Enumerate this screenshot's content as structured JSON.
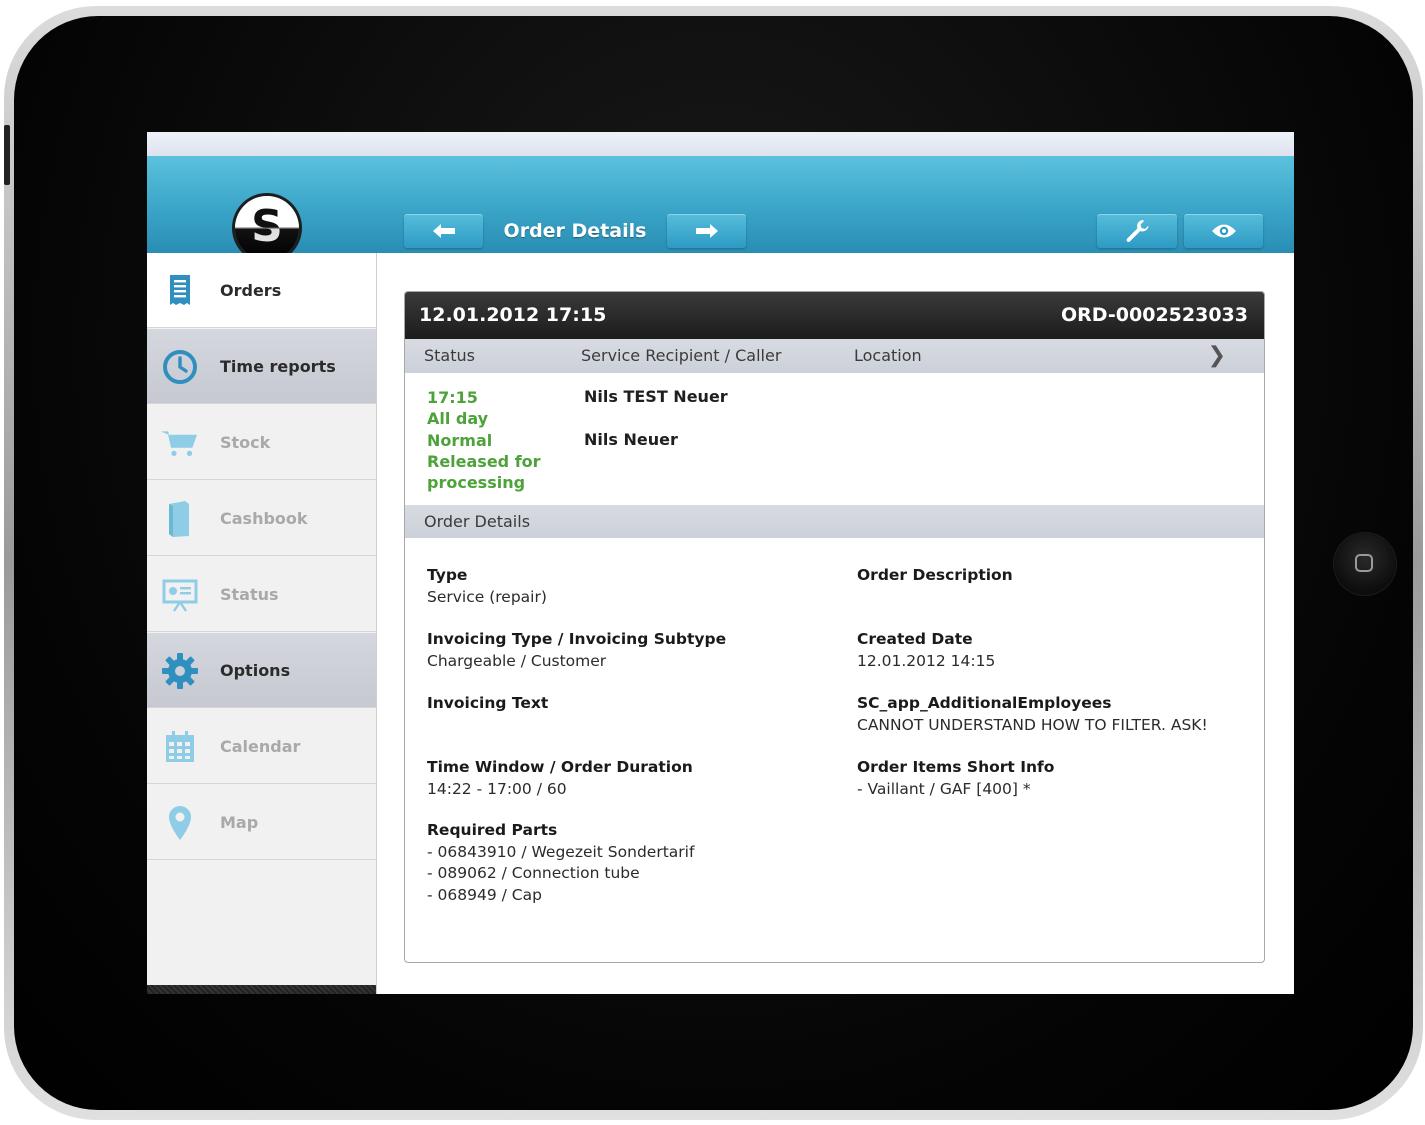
{
  "header": {
    "title": "Order Details",
    "back_icon": "arrow-left-icon",
    "forward_icon": "arrow-right-icon",
    "tools_icon": "wrench-icon",
    "view_icon": "eye-icon"
  },
  "sidebar": {
    "items": [
      {
        "label": "Orders",
        "icon": "receipt-icon"
      },
      {
        "label": "Time reports",
        "icon": "clock-icon"
      },
      {
        "label": "Stock",
        "icon": "cart-icon"
      },
      {
        "label": "Cashbook",
        "icon": "book-icon"
      },
      {
        "label": "Status",
        "icon": "presentation-icon"
      },
      {
        "label": "Options",
        "icon": "gear-icon"
      },
      {
        "label": "Calendar",
        "icon": "calendar-icon"
      },
      {
        "label": "Map",
        "icon": "map-pin-icon"
      }
    ]
  },
  "order": {
    "datetime": "12.01.2012 17:15",
    "number": "ORD-0002523033",
    "columns": {
      "status": "Status",
      "recipient": "Service Recipient / Caller",
      "location": "Location"
    },
    "status_lines": [
      "17:15",
      "All day",
      "Normal",
      "Released for",
      "processing"
    ],
    "recipient_primary": "Nils TEST Neuer",
    "recipient_secondary": "Nils Neuer",
    "details_heading": "Order Details",
    "fields": {
      "type": {
        "label": "Type",
        "value": "Service (repair)"
      },
      "invoicing_type": {
        "label": "Invoicing Type / Invoicing Subtype",
        "value": "Chargeable / Customer"
      },
      "invoicing_text": {
        "label": "Invoicing Text",
        "value": ""
      },
      "time_window": {
        "label": "Time Window / Order Duration",
        "value": "14:22 - 17:00 / 60"
      },
      "required_parts": {
        "label": "Required Parts",
        "lines": [
          "- 06843910 / Wegezeit Sondertarif",
          "- 089062 / Connection tube",
          "- 068949 / Cap"
        ]
      },
      "order_description": {
        "label": "Order Description",
        "value": ""
      },
      "created_date": {
        "label": "Created Date",
        "value": "12.01.2012 14:15"
      },
      "additional_employees": {
        "label": "SC_app_AdditionalEmployees",
        "value": "CANNOT UNDERSTAND HOW TO FILTER. ASK!"
      },
      "items_short_info": {
        "label": "Order Items Short Info",
        "value": "- Vaillant / GAF [400] *"
      }
    }
  },
  "colors": {
    "accent": "#3aa5c8",
    "status_green": "#4da33a",
    "card_header": "#1c1c1c"
  }
}
